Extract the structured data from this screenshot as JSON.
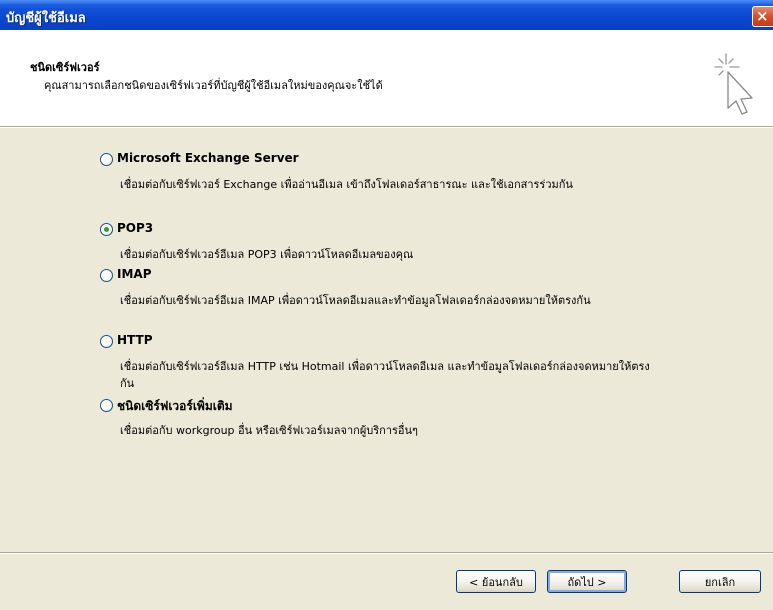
{
  "window": {
    "title": "บัญชีผู้ใช้อีเมล",
    "close_label": "×"
  },
  "header": {
    "title": "ชนิดเซิร์ฟเวอร์",
    "subtitle": "คุณสามารถเลือกชนิดของเซิร์ฟเวอร์ที่บัญชีผู้ใช้อีเมลใหม่ของคุณจะใช้ได้"
  },
  "options": [
    {
      "label": "Microsoft Exchange Server",
      "desc": "เชื่อมต่อกับเซิร์ฟเวอร์ Exchange เพื่ออ่านอีเมล เข้าถึงโฟลเดอร์สาธารณะ และใช้เอกสารร่วมกัน",
      "checked": false
    },
    {
      "label": "POP3",
      "desc": "เชื่อมต่อกับเซิร์ฟเวอร์อีเมล POP3 เพื่อดาวน์โหลดอีเมลของคุณ",
      "checked": true
    },
    {
      "label": "IMAP",
      "desc": "เชื่อมต่อกับเซิร์ฟเวอร์อีเมล IMAP เพื่อดาวน์โหลดอีเมลและทำข้อมูลโฟลเดอร์กล่องจดหมายให้ตรงกัน",
      "checked": false
    },
    {
      "label": "HTTP",
      "desc": "เชื่อมต่อกับเซิร์ฟเวอร์อีเมล HTTP เช่น Hotmail เพื่อดาวน์โหลดอีเมล และทำข้อมูลโฟลเดอร์กล่องจดหมายให้ตรงกัน",
      "checked": false
    },
    {
      "label": "ชนิดเซิร์ฟเวอร์เพิ่มเติม",
      "desc": "เชื่อมต่อกับ workgroup อื่น หรือเซิร์ฟเวอร์เมลจากผู้บริการอื่นๆ",
      "checked": false
    }
  ],
  "buttons": {
    "back": "< ย้อนกลับ",
    "next": "ถัดไป >",
    "cancel": "ยกเลิก"
  },
  "icons": {
    "wizard": "sparkle-cursor-icon",
    "close": "close-icon"
  },
  "colors": {
    "titlebar": "#0b47cf",
    "dialog_background": "#ece9d8",
    "header_background": "#ffffff",
    "close_button": "#d6532f",
    "radio_selected": "#2f9b2f"
  }
}
